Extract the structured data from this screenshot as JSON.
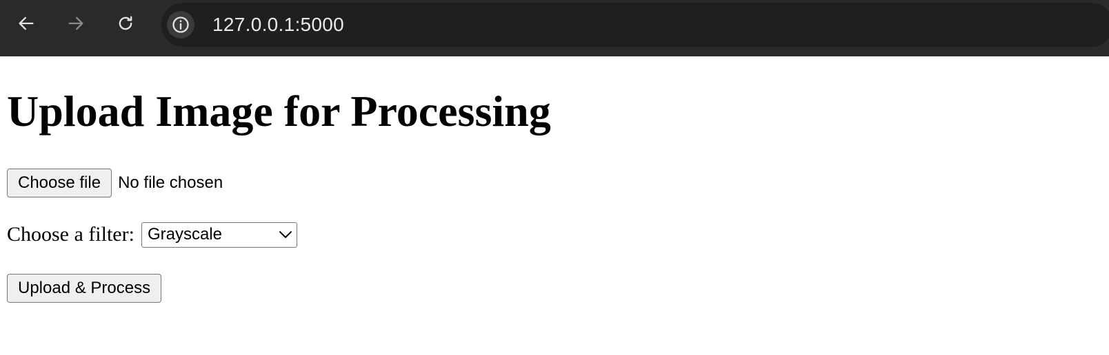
{
  "browser": {
    "url": "127.0.0.1:5000"
  },
  "page": {
    "heading": "Upload Image for Processing",
    "file_input": {
      "button_label": "Choose file",
      "status": "No file chosen"
    },
    "filter": {
      "label": "Choose a filter:",
      "selected": "Grayscale"
    },
    "submit_label": "Upload & Process"
  }
}
